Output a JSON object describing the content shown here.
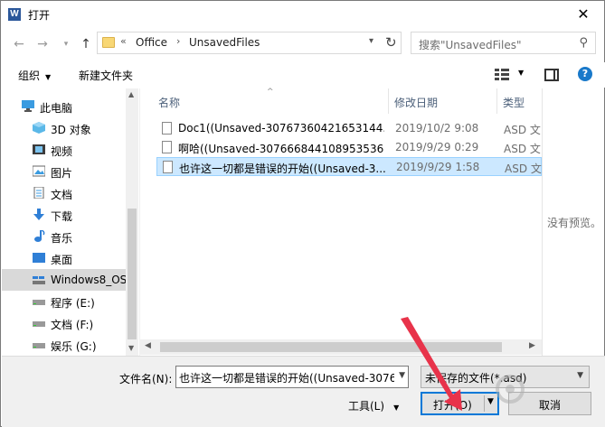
{
  "window": {
    "title": "打开",
    "app_icon_letter": "W"
  },
  "address_bar": {
    "overflow": "«",
    "crumbs": [
      "Office",
      "UnsavedFiles"
    ],
    "separator": "›"
  },
  "search": {
    "placeholder": "搜索\"UnsavedFiles\""
  },
  "toolbar": {
    "organize": "组织",
    "new_folder": "新建文件夹"
  },
  "nav_pane": {
    "items": [
      {
        "label": "此电脑",
        "icon": "computer-icon"
      },
      {
        "label": "3D 对象",
        "icon": "3d-objects-icon"
      },
      {
        "label": "视频",
        "icon": "video-icon"
      },
      {
        "label": "图片",
        "icon": "picture-icon"
      },
      {
        "label": "文档",
        "icon": "document-icon"
      },
      {
        "label": "下载",
        "icon": "download-icon"
      },
      {
        "label": "音乐",
        "icon": "music-icon"
      },
      {
        "label": "桌面",
        "icon": "desktop-icon"
      },
      {
        "label": "Windows8_OS",
        "icon": "drive-icon",
        "selected": true
      },
      {
        "label": "程序 (E:)",
        "icon": "drive-icon"
      },
      {
        "label": "文档 (F:)",
        "icon": "drive-icon"
      },
      {
        "label": "娱乐 (G:)",
        "icon": "drive-icon"
      }
    ]
  },
  "file_list": {
    "columns": [
      "名称",
      "修改日期",
      "类型"
    ],
    "rows": [
      {
        "name": "Doc1((Unsaved-30767360421653144...",
        "date": "2019/10/2 9:08",
        "type": "ASD 文"
      },
      {
        "name": "啊哈((Unsaved-307666844108953536)...",
        "date": "2019/9/29 0:29",
        "type": "ASD 文"
      },
      {
        "name": "也许这一切都是错误的开始((Unsaved-3...",
        "date": "2019/9/29 1:58",
        "type": "ASD 文",
        "selected": true
      }
    ]
  },
  "preview": {
    "text": "没有预览。"
  },
  "bottom": {
    "filename_label": "文件名(N):",
    "filename_value": "也许这一切都是错误的开始((Unsaved-3076",
    "filetype_value": "未保存的文件(*.asd)",
    "tools_label": "工具(L)",
    "open_label": "打开(O)",
    "cancel_label": "取消"
  },
  "colors": {
    "accent": "#0078d7",
    "selection": "#cce8ff",
    "annotation_arrow": "#e8334a"
  }
}
